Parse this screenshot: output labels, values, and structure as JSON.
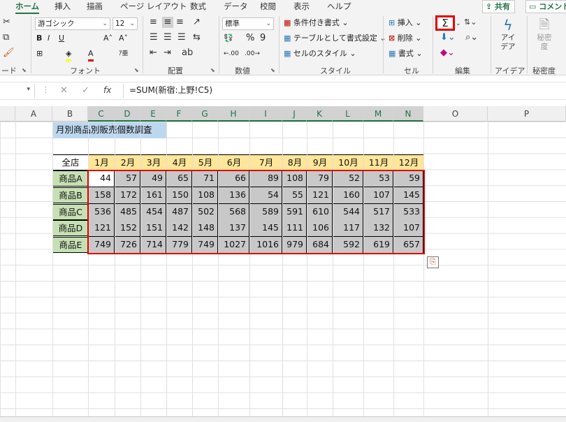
{
  "tabs": [
    "ホーム",
    "挿入",
    "描画",
    "ページ レイアウト",
    "数式",
    "データ",
    "校閲",
    "表示",
    "ヘルプ"
  ],
  "share": {
    "share_label": "共有",
    "comment_label": "コメント"
  },
  "ribbon": {
    "clipboard_label": "ード",
    "font": {
      "name": "游ゴシック",
      "size": "12",
      "label": "フォント"
    },
    "align_label": "配置",
    "number": {
      "format": "標準",
      "label": "数値"
    },
    "styles": {
      "conditional": "条件付き書式",
      "as_table": "テーブルとして書式設定",
      "cell_styles": "セルのスタイル",
      "label": "スタイル"
    },
    "cells": {
      "insert": "挿入",
      "delete": "削除",
      "format": "書式",
      "label": "セル"
    },
    "editing_label": "編集",
    "ideas": {
      "button": "アイ\nデア",
      "label": "アイデア"
    },
    "sensitivity": {
      "button": "秘密\n度",
      "label": "秘密度"
    }
  },
  "formula_bar": {
    "formula": "=SUM(新宿:上野!C5)"
  },
  "columns": [
    "A",
    "B",
    "C",
    "D",
    "E",
    "F",
    "G",
    "H",
    "I",
    "J",
    "K",
    "L",
    "M",
    "N",
    "O",
    "P"
  ],
  "sheet": {
    "title": "月別商品別販売個数調査",
    "corner": "全店",
    "months": [
      "1月",
      "2月",
      "3月",
      "4月",
      "5月",
      "6月",
      "7月",
      "8月",
      "9月",
      "10月",
      "11月",
      "12月"
    ],
    "rows": [
      {
        "label": "商品A",
        "values": [
          "44",
          "57",
          "49",
          "65",
          "71",
          "66",
          "89",
          "108",
          "79",
          "52",
          "53",
          "59"
        ]
      },
      {
        "label": "商品B",
        "values": [
          "158",
          "172",
          "161",
          "150",
          "108",
          "136",
          "54",
          "55",
          "121",
          "160",
          "107",
          "145"
        ]
      },
      {
        "label": "商品C",
        "values": [
          "536",
          "485",
          "454",
          "487",
          "502",
          "568",
          "589",
          "591",
          "610",
          "544",
          "517",
          "533"
        ]
      },
      {
        "label": "商品D",
        "values": [
          "121",
          "152",
          "151",
          "142",
          "148",
          "137",
          "145",
          "111",
          "106",
          "117",
          "132",
          "107"
        ]
      },
      {
        "label": "商品E",
        "values": [
          "749",
          "726",
          "714",
          "779",
          "749",
          "1027",
          "1016",
          "979",
          "684",
          "592",
          "619",
          "657"
        ]
      }
    ]
  },
  "colors": {
    "accent": "#217346",
    "highlight": "#e00000",
    "title_fill": "#bdd7ee",
    "header_fill": "#ffe699",
    "label_fill": "#c6e0b4"
  }
}
